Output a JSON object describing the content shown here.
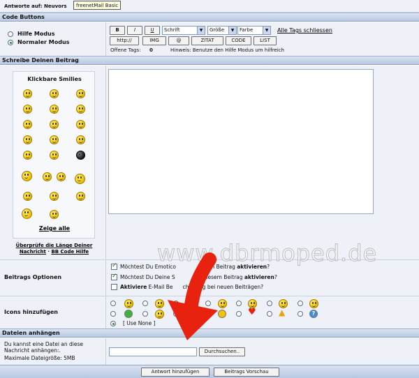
{
  "header": {
    "antworte_label": "Antworte auf:",
    "thread_partial": "Neuvors",
    "tooltip": "freenetMail Basic"
  },
  "code_buttons": {
    "section_title": "Code Buttons",
    "modes": [
      {
        "label": "Hilfe Modus",
        "selected": false
      },
      {
        "label": "Normaler Modus",
        "selected": true
      }
    ],
    "buttons_row1": [
      "B",
      "I",
      "U"
    ],
    "schrift": "Schrift",
    "groesse": "Größe",
    "farbe": "Farbe",
    "close_tags": "Alle Tags schliessen",
    "buttons_row2": [
      "http://",
      "IMG",
      "@",
      "ZITAT",
      "CODE",
      "LIST"
    ],
    "open_tags_label": "Offene Tags:",
    "open_tags_value": "0",
    "hint": "Hinweis: Benutze den Hilfe Modus um hilfreich"
  },
  "compose": {
    "section_title": "Schreibe Deinen Beitrag",
    "smilies_title": "Klickbare Smilies",
    "show_all": "Zeige alle",
    "check_length": "Überprüfe die Länge Deiner Nachricht",
    "separator": "·",
    "bbcode_help": "BB Code Hilfe",
    "message_value": ""
  },
  "options": {
    "label": "Beitrags Optionen",
    "items": [
      {
        "pre": "Möchtest Du Emotico",
        "bold": "aktivieren",
        "post": "?",
        "middle": "esem Beitrag",
        "checked": true
      },
      {
        "pre": "Möchtest Du Deine S",
        "bold": "aktivieren",
        "post": "?",
        "middle": "in diesem Beitrag",
        "checked": true
      },
      {
        "pre": "",
        "bold": "Aktiviere",
        "post": "",
        "middle": "E-Mail Be",
        "tail": "chtigung bei neuen Beiträgen?",
        "checked": false
      }
    ]
  },
  "icons": {
    "label": "Icons hinzufügen",
    "use_none": "[ Use None ]"
  },
  "attachments": {
    "section_title": "Dateien anhängen",
    "description": "Du kannst eine Datei an diese Nachricht anhängen:.",
    "max_size": "Maximale Dateigröße: 5MB",
    "browse": "Durchsuchen..",
    "file_value": ""
  },
  "footer": {
    "submit": "Antwort hinzufügen",
    "preview": "Beitrags Vorschau"
  },
  "watermark": {
    "text": "www.dbrmoped.de"
  },
  "colors": {
    "section_bar": "#c4d2ea",
    "panel": "#eef1f8",
    "arrow": "#e8220e"
  }
}
